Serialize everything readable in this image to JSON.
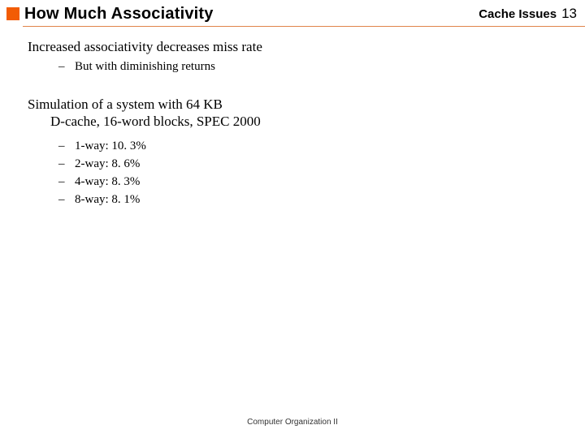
{
  "header": {
    "title": "How Much Associativity",
    "topic": "Cache Issues",
    "page": "13"
  },
  "section1": {
    "heading": "Increased associativity decreases miss rate",
    "sub": "But with diminishing returns"
  },
  "section2": {
    "line1": "Simulation of a system with 64 KB",
    "line2": "D-cache, 16-word blocks, SPEC 2000",
    "items": [
      "1-way: 10. 3%",
      "2-way: 8. 6%",
      "4-way: 8. 3%",
      "8-way: 8. 1%"
    ]
  },
  "footer": "Computer Organization II"
}
